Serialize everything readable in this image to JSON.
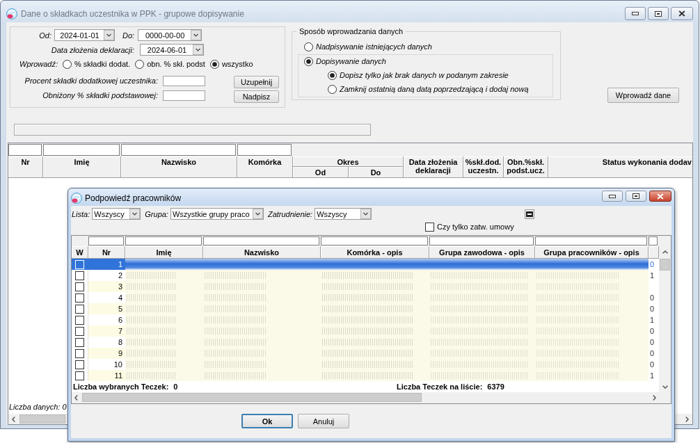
{
  "main_window": {
    "title": "Dane o składkach uczestnika w PPK - grupowe dopisywanie",
    "active": false,
    "date_fields": [
      {
        "label": "Od:",
        "value": "2024-01-01"
      },
      {
        "label": "Do:",
        "value": "0000-00-00"
      },
      {
        "label": "Data złożenia deklaracji:",
        "value": "2024-06-01"
      }
    ],
    "wprowadz": {
      "label": "Wprowadź:",
      "options": [
        {
          "label": "% składki dodat.",
          "selected": false
        },
        {
          "label": "obn. % skł. podst",
          "selected": false
        },
        {
          "label": "wszystko",
          "selected": true
        }
      ]
    },
    "percent_fields": [
      {
        "label": "Procent składki dodatkowej uczestnika:",
        "button": "Uzupełnij"
      },
      {
        "label": "Obniżony % składki podstawowej:",
        "button": "Nadpisz"
      }
    ],
    "mode_group": {
      "title": "Sposób wprowadzania danych",
      "options": [
        {
          "label": "Nadpisywanie istniejących danych",
          "selected": false
        },
        {
          "label": "Dopisywanie danych",
          "selected": true,
          "children": [
            {
              "label": "Dopisz tylko jak brak danych w podanym zakresie",
              "selected": true
            },
            {
              "label": "Zamknij ostatnią daną datą poprzedzającą i dodaj nową",
              "selected": false
            }
          ]
        }
      ]
    },
    "submit_button": "Wprowadź dane",
    "table": {
      "columns": [
        {
          "label": "Nr",
          "filter": true
        },
        {
          "label": "Imię",
          "filter": true
        },
        {
          "label": "Nazwisko",
          "filter": true
        },
        {
          "label": "Komórka",
          "filter": true
        },
        {
          "label": "Okres",
          "filter": false,
          "children": [
            {
              "label": "Od"
            },
            {
              "label": "Do"
            }
          ]
        },
        {
          "label": "Data złożenia deklaracji",
          "filter": false
        },
        {
          "label": "%skł.dod. uczestn.",
          "filter": false
        },
        {
          "label": "Obn.%skł. podst.ucz.",
          "filter": false
        },
        {
          "label": "Status wykonania dodav",
          "filter": false
        }
      ],
      "status": "Liczba danych: 0"
    }
  },
  "popup": {
    "title": "Podpowiedź pracowników",
    "active": true,
    "filters": [
      {
        "label": "Lista:",
        "value": "Wszyscy"
      },
      {
        "label": "Grupa:",
        "value": "Wszystkie grupy praco"
      },
      {
        "label": "Zatrudnienie:",
        "value": "Wszyscy"
      }
    ],
    "checkbox": {
      "label": "Czy tylko zatw. umowy",
      "checked": false
    },
    "grid": {
      "columns": [
        {
          "label": "W",
          "filter": false
        },
        {
          "label": "Nr",
          "filter": true
        },
        {
          "label": "Imię",
          "filter": true
        },
        {
          "label": "Nazwisko",
          "filter": true
        },
        {
          "label": "Komórka - opis",
          "filter": true
        },
        {
          "label": "Grupa zawodowa - opis",
          "filter": true
        },
        {
          "label": "Grupa pracowników - opis",
          "filter": true
        },
        {
          "filter": true
        }
      ],
      "rows": [
        {
          "nr": "1",
          "checked": false,
          "selected": true,
          "column_8": "0"
        },
        {
          "nr": "2",
          "checked": false,
          "selected": false,
          "column_8": "1"
        },
        {
          "nr": "3",
          "checked": false,
          "selected": false
        },
        {
          "nr": "4",
          "checked": false,
          "selected": false,
          "column_8": "0"
        },
        {
          "nr": "5",
          "checked": false,
          "selected": false,
          "column_8": "0"
        },
        {
          "nr": "6",
          "checked": false,
          "selected": false,
          "column_8": "1"
        },
        {
          "nr": "7",
          "checked": false,
          "selected": false,
          "column_8": "0"
        },
        {
          "nr": "8",
          "checked": false,
          "selected": false,
          "column_8": "0"
        },
        {
          "nr": "9",
          "checked": false,
          "selected": false,
          "column_8": "0"
        },
        {
          "nr": "10",
          "checked": false,
          "selected": false,
          "column_8": "0"
        },
        {
          "nr": "11",
          "checked": false,
          "selected": false,
          "column_8": "1"
        }
      ],
      "selected_count": {
        "label": "Liczba wybranych Teczek:",
        "value": "0"
      },
      "total_count": {
        "label": "Liczba Teczek na liście:",
        "value": "6379"
      }
    },
    "buttons": [
      {
        "label": "Ok",
        "default": true
      },
      {
        "label": "Anuluj",
        "default": false
      }
    ]
  }
}
